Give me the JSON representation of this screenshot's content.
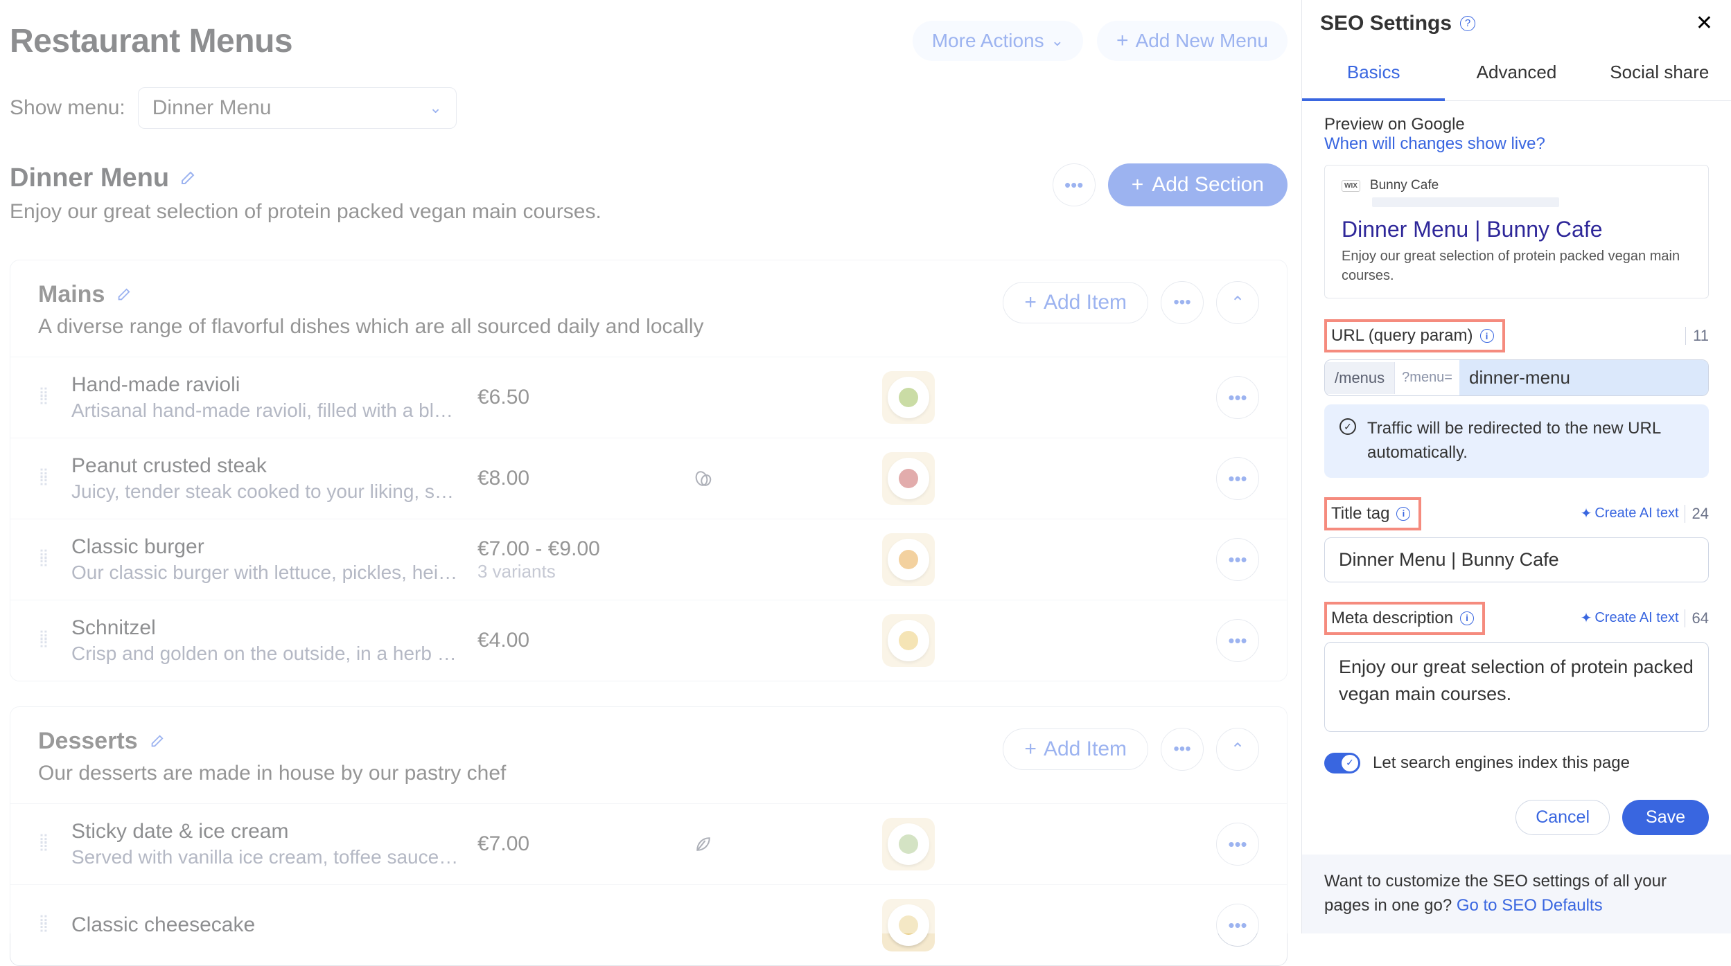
{
  "header": {
    "title": "Restaurant Menus",
    "more_actions": "More Actions",
    "add_menu": "Add New Menu"
  },
  "filter": {
    "label": "Show menu:",
    "selected": "Dinner Menu"
  },
  "menu": {
    "title": "Dinner Menu",
    "subtitle": "Enjoy our great selection of protein packed vegan main courses.",
    "add_section": "Add Section"
  },
  "sections": [
    {
      "title": "Mains",
      "subtitle": "A diverse range of flavorful dishes which are all sourced daily and locally",
      "add_item": "Add Item",
      "items": [
        {
          "name": "Hand-made ravioli",
          "desc": "Artisanal hand-made ravioli, filled with a blend of …",
          "price": "€6.50",
          "variants": "",
          "flag": "",
          "food_color": "#94b84b"
        },
        {
          "name": "Peanut crusted steak",
          "desc": "Juicy, tender steak cooked to your liking, served …",
          "price": "€8.00",
          "variants": "",
          "flag": "allergen",
          "food_color": "#c45858"
        },
        {
          "name": "Classic burger",
          "desc": "Our classic burger with lettuce, pickles, heirloom …",
          "price": "€7.00 - €9.00",
          "variants": "3 variants",
          "flag": "",
          "food_color": "#e7a33e"
        },
        {
          "name": "Schnitzel",
          "desc": "Crisp and golden on the outside, in a herb and pa…",
          "price": "€4.00",
          "variants": "",
          "flag": "",
          "food_color": "#ebc96a"
        }
      ]
    },
    {
      "title": "Desserts",
      "subtitle": "Our desserts are made in house by our pastry chef",
      "add_item": "Add Item",
      "items": [
        {
          "name": "Sticky date & ice cream",
          "desc": "Served with vanilla ice cream, toffee sauce & a pe…",
          "price": "€7.00",
          "variants": "",
          "flag": "vegan",
          "food_color": "#a8c689"
        },
        {
          "name": "Classic cheesecake",
          "desc": "",
          "price": "",
          "variants": "",
          "flag": "",
          "food_color": "#e9d08a"
        }
      ]
    }
  ],
  "panel": {
    "title": "SEO Settings",
    "tabs": {
      "basics": "Basics",
      "advanced": "Advanced",
      "social": "Social share"
    },
    "preview": {
      "label": "Preview on Google",
      "link": "When will changes show live?",
      "site": "Bunny Cafe",
      "title": "Dinner Menu | Bunny Cafe",
      "desc": "Enjoy our great selection of protein packed vegan main courses."
    },
    "url": {
      "label": "URL (query param)",
      "count": "11",
      "base": "/menus",
      "param": "?menu=",
      "value": "dinner-menu",
      "redirect_notice": "Traffic will be redirected to the new URL automatically."
    },
    "title_field": {
      "label": "Title tag",
      "create_ai": "Create AI text",
      "count": "24",
      "value": "Dinner Menu | Bunny Cafe"
    },
    "meta": {
      "label": "Meta description",
      "create_ai": "Create AI text",
      "count": "64",
      "value": "Enjoy our great selection of protein packed vegan main courses."
    },
    "index": {
      "label": "Let search engines index this page"
    },
    "actions": {
      "cancel": "Cancel",
      "save": "Save"
    },
    "footer": {
      "text": "Want to customize the SEO settings of all your pages in one go? ",
      "link": "Go to SEO Defaults"
    }
  }
}
